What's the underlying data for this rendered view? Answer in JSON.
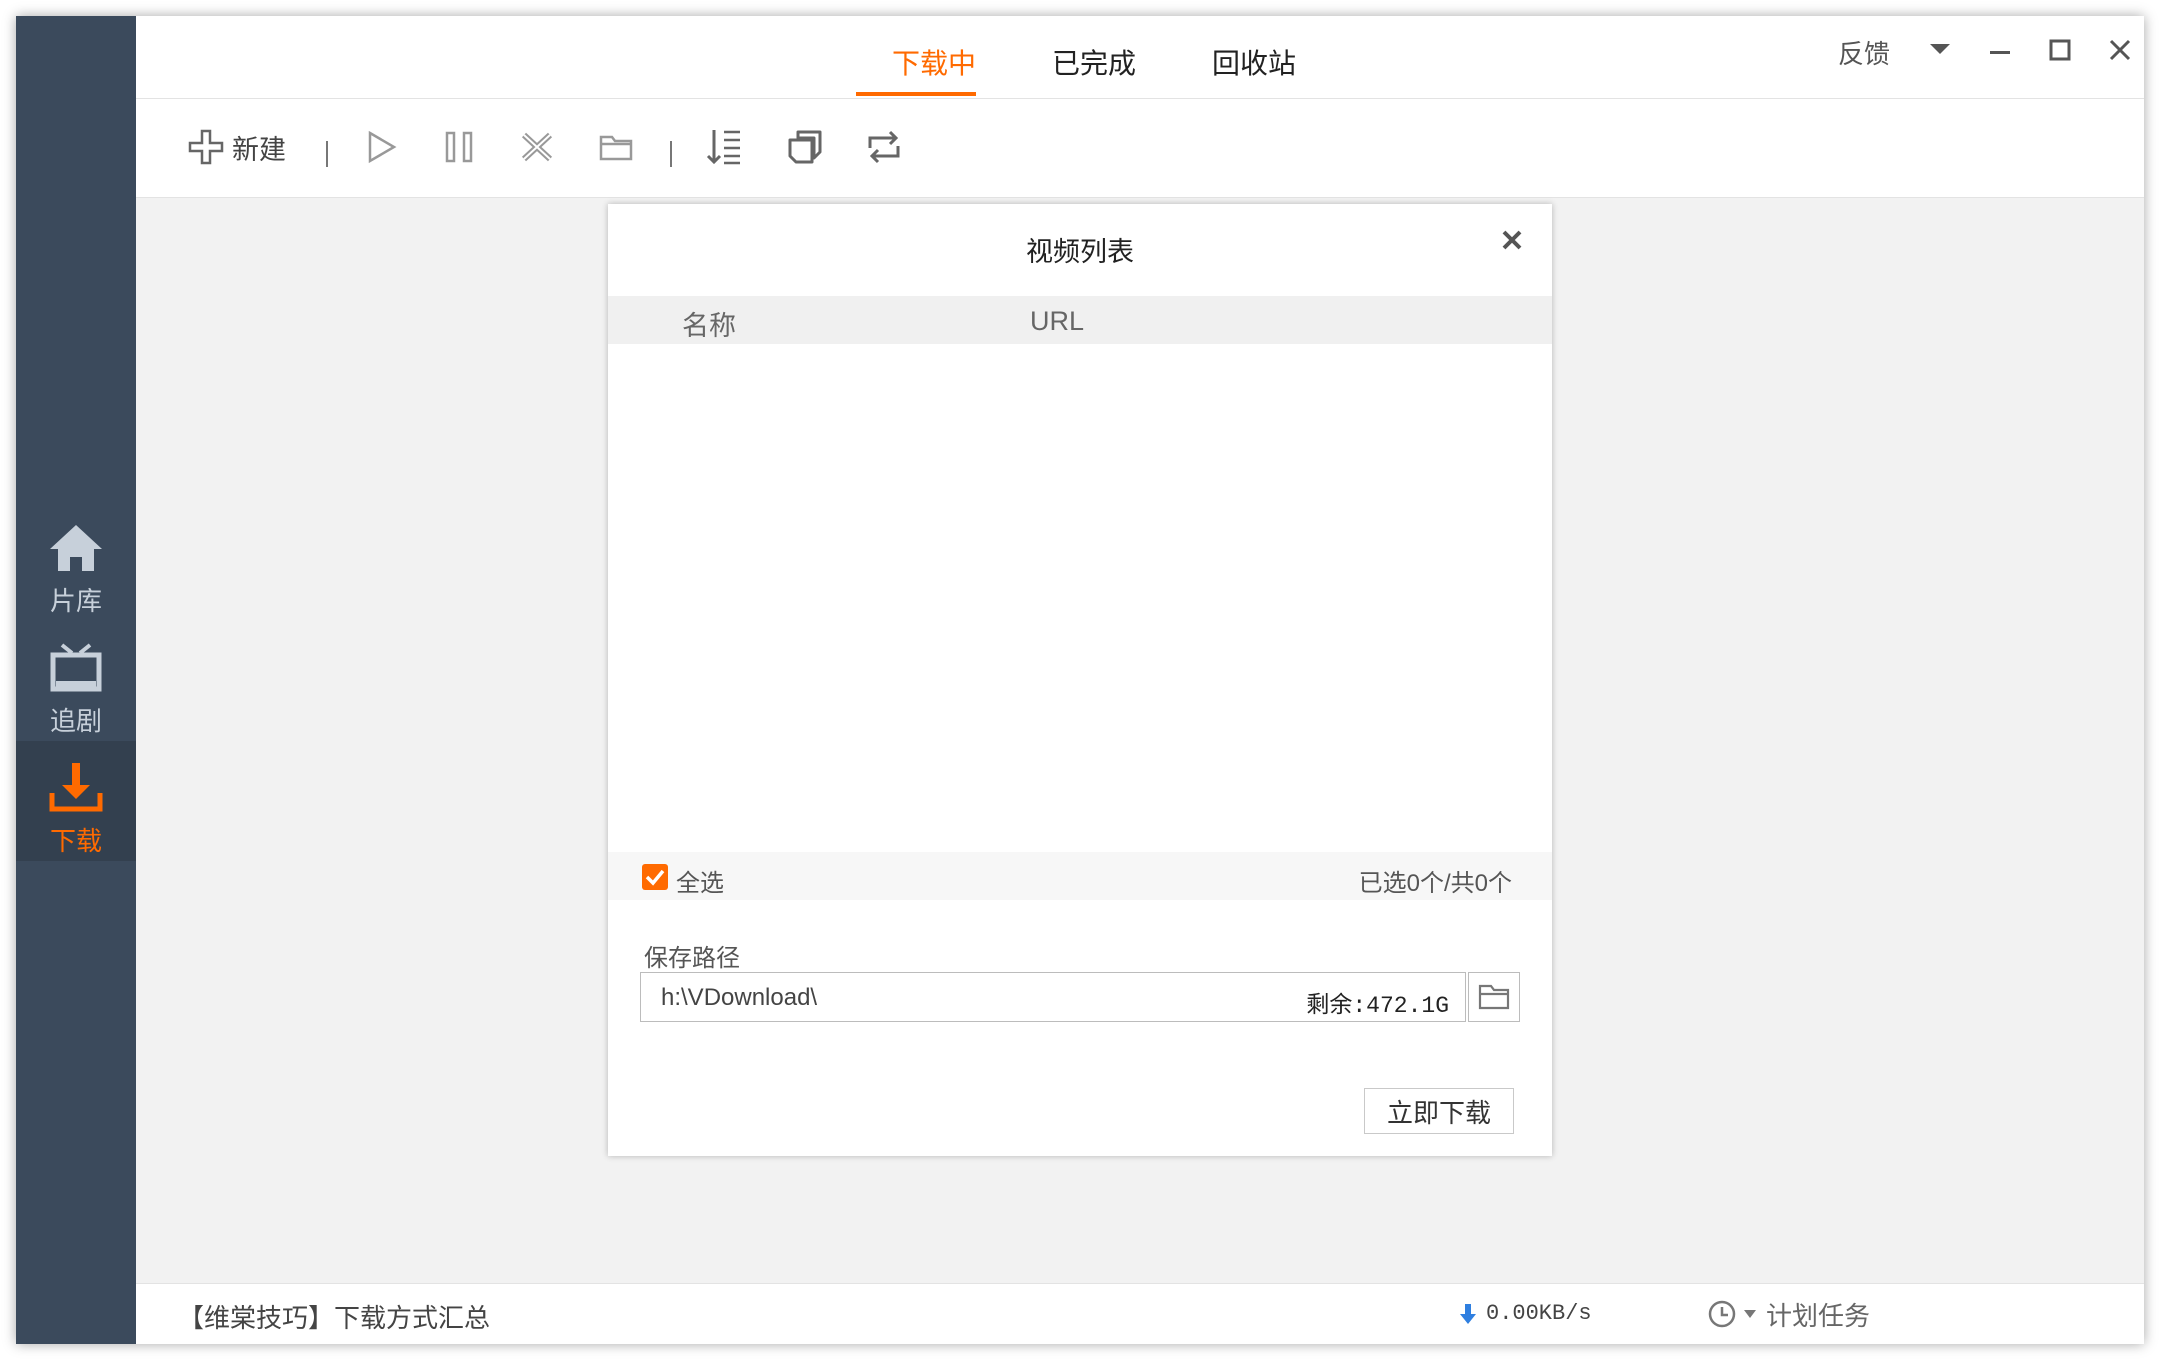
{
  "sidebar": {
    "items": [
      {
        "label": "片库",
        "icon": "home-icon"
      },
      {
        "label": "追剧",
        "icon": "tv-icon"
      },
      {
        "label": "下载",
        "icon": "download-icon",
        "active": true
      }
    ]
  },
  "tabs": [
    {
      "label": "下载中",
      "active": true
    },
    {
      "label": "已完成"
    },
    {
      "label": "回收站"
    }
  ],
  "window_controls": {
    "feedback": "反馈"
  },
  "toolbar": {
    "new_label": "新建"
  },
  "dialog": {
    "title": "视频列表",
    "columns": {
      "name": "名称",
      "url": "URL"
    },
    "select_all": "全选",
    "selection_count": "已选0个/共0个",
    "path_label": "保存路径",
    "path_value": "h:\\VDownload\\",
    "remaining": "剩余:472.1G",
    "download_button": "立即下载"
  },
  "statusbar": {
    "tip": "【维棠技巧】下载方式汇总",
    "speed": "0.00KB/s",
    "schedule": "计划任务"
  },
  "colors": {
    "accent": "#ff6a00",
    "sidebar": "#3b4a5c"
  }
}
